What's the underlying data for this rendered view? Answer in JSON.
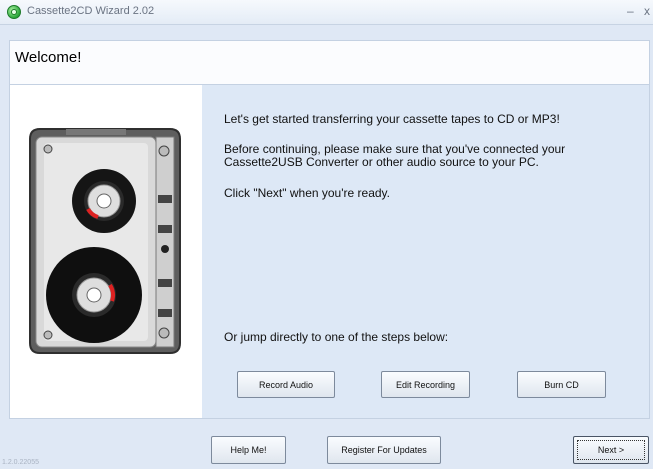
{
  "window": {
    "title": "Cassette2CD Wizard 2.02",
    "minimize_glyph": "–",
    "close_glyph": "x",
    "app_icon": "cassette-disc-icon"
  },
  "page": {
    "heading": "Welcome!"
  },
  "content": {
    "intro": "Let's get started transferring your cassette tapes to CD or MP3!",
    "instructions": "Before continuing, please make sure that you've connected your Cassette2USB Converter or other audio source to your PC.",
    "ready_text": "Click \"Next\" when you're ready.",
    "jump_text": "Or jump directly to one of the steps below:",
    "image": "cassette-tape-illustration"
  },
  "steps": {
    "record_label": "Record Audio",
    "edit_label": "Edit Recording",
    "burn_label": "Burn CD"
  },
  "footer": {
    "help_label": "Help Me!",
    "register_label": "Register For Updates",
    "next_label": "Next >",
    "version": "1.2.0.22055"
  },
  "colors": {
    "background": "#dfe8f5",
    "pane": "#dde8f6",
    "border": "#c4d1e2"
  }
}
